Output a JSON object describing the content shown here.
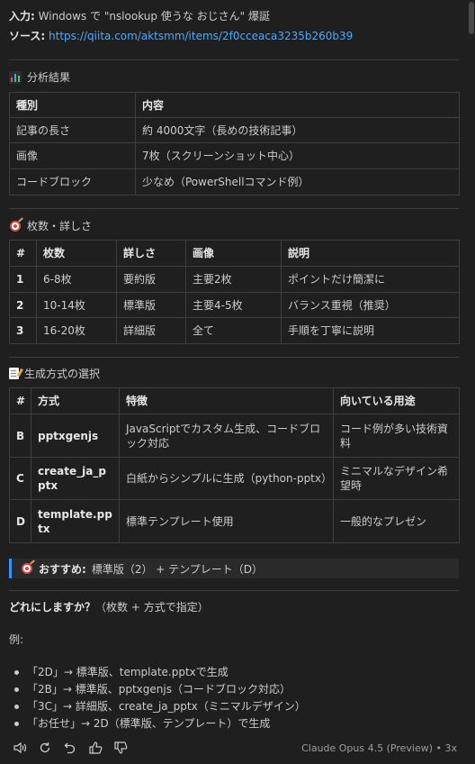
{
  "source": {
    "input_label": "入力:",
    "input_value": "Windows で \"nslookup 使うな おじさん\" 爆誕",
    "source_label": "ソース:",
    "source_url": "https://qiita.com/aktsmm/items/2f0cceaca3235b260b39"
  },
  "analysis": {
    "title": "分析結果",
    "headers": [
      "種別",
      "内容"
    ],
    "rows": [
      [
        "記事の長さ",
        "約 4000文字（長めの技術記事）"
      ],
      [
        "画像",
        "7枚（スクリーンショット中心）"
      ],
      [
        "コードブロック",
        "少なめ（PowerShellコマンド例）"
      ]
    ]
  },
  "counts": {
    "title": "枚数・詳しさ",
    "headers": [
      "#",
      "枚数",
      "詳しさ",
      "画像",
      "説明"
    ],
    "rows": [
      [
        "1",
        "6-8枚",
        "要約版",
        "主要2枚",
        "ポイントだけ簡潔に"
      ],
      [
        "2",
        "10-14枚",
        "標準版",
        "主要4-5枚",
        "バランス重視（推奨）"
      ],
      [
        "3",
        "16-20枚",
        "詳細版",
        "全て",
        "手順を丁寧に説明"
      ]
    ]
  },
  "methods": {
    "title": "生成方式の選択",
    "headers": [
      "#",
      "方式",
      "特徴",
      "向いている用途"
    ],
    "rows": [
      [
        "B",
        "pptxgenjs",
        "JavaScriptでカスタム生成、コードブロック対応",
        "コード例が多い技術資料"
      ],
      [
        "C",
        "create_ja_pptx",
        "白紙からシンプルに生成（python-pptx）",
        "ミニマルなデザイン希望時"
      ],
      [
        "D",
        "template.pptx",
        "標準テンプレート使用",
        "一般的なプレゼン"
      ]
    ]
  },
  "recommend": {
    "label": "おすすめ:",
    "value": "標準版（2） + テンプレート（D）"
  },
  "question": {
    "bold": "どれにしますか？",
    "rest": "（枚数 + 方式で指定）"
  },
  "example_label": "例:",
  "options": [
    "「2D」→ 標準版、template.pptxで生成",
    "「2B」→ 標準版、pptxgenjs（コードブロック対応）",
    "「3C」→ 詳細版、create_ja_pptx（ミニマルデザイン）",
    "「お任せ」→ 2D（標準版、テンプレート）で生成"
  ],
  "footer": {
    "model": "Claude Opus 4.5 (Preview) • 3x"
  },
  "icons": {
    "speaker": "speaker-icon",
    "retry": "retry-icon",
    "undo": "undo-icon",
    "thumbs_up": "thumbs-up-icon",
    "thumbs_down": "thumbs-down-icon"
  },
  "colors": {
    "background": "#1f1f1f",
    "link": "#4daafc",
    "accent": "#3794ff",
    "text": "#cccccc"
  }
}
